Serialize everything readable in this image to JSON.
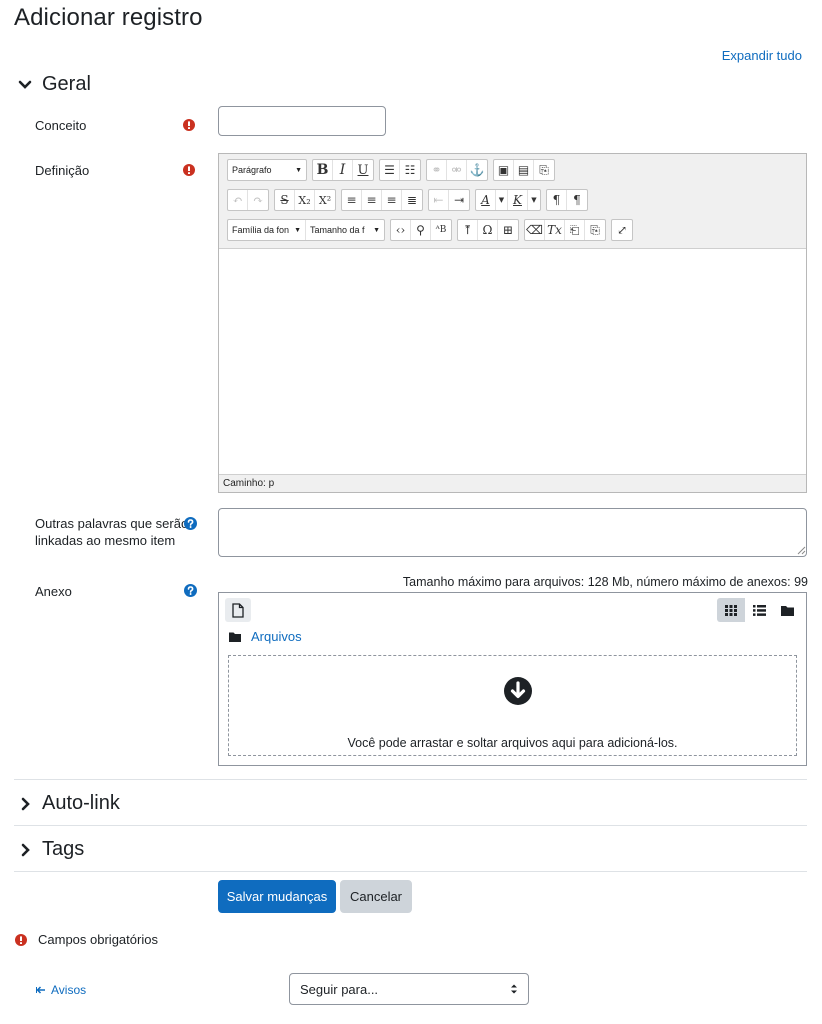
{
  "page": {
    "title": "Adicionar registro",
    "expand_all": "Expandir tudo"
  },
  "sections": {
    "general": "Geral",
    "autolink": "Auto-link",
    "tags": "Tags"
  },
  "fields": {
    "concept_label": "Conceito",
    "concept_value": "",
    "definition_label": "Definição",
    "aliases_label_line1": "Outras palavras que serão",
    "aliases_label_line2": "linkadas ao mesmo item",
    "attachment_label": "Anexo"
  },
  "editor": {
    "format_select": "Parágrafo",
    "font_family_select": "Família da fon",
    "font_size_select": "Tamanho da f",
    "path": "Caminho: p"
  },
  "filemanager": {
    "limits": "Tamanho máximo para arquivos: 128 Mb, número máximo de anexos: 99",
    "folder": "Arquivos",
    "drop_hint": "Você pode arrastar e soltar arquivos aqui para adicioná-los."
  },
  "actions": {
    "save": "Salvar mudanças",
    "cancel": "Cancelar"
  },
  "footer": {
    "required_note": "Campos obrigatórios",
    "prev_link": "Avisos",
    "jump_to": "Seguir para..."
  },
  "colors": {
    "primary": "#0f6cbf",
    "required": "#ca3120",
    "secondary_button": "#ced4da"
  }
}
